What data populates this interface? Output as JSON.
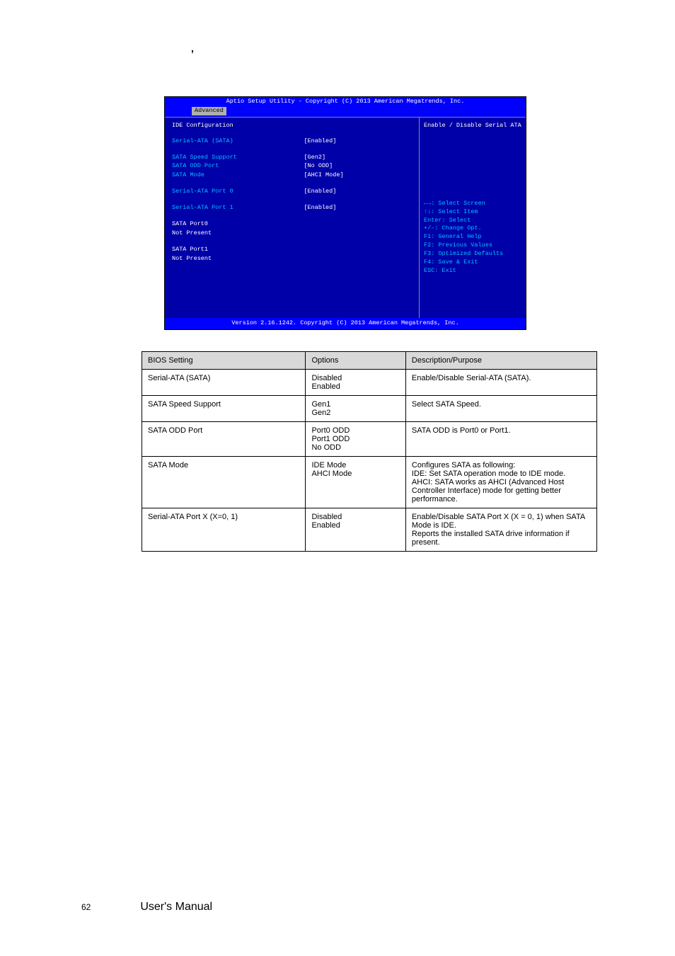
{
  "stray": ",",
  "bios": {
    "topbar": "Aptio Setup Utility - Copyright (C) 2013 American Megatrends, Inc.",
    "tab": "Advanced",
    "heading": "IDE Configuration",
    "rows": [
      {
        "label": "Serial-ATA (SATA)",
        "value": "[Enabled]",
        "white": false
      },
      {
        "spacer": true
      },
      {
        "label": "SATA Speed Support",
        "value": "[Gen2]"
      },
      {
        "label": "SATA ODD Port",
        "value": "[No ODD]"
      },
      {
        "label": "SATA Mode",
        "value": "[AHCI Mode]"
      },
      {
        "spacer": true
      },
      {
        "label": "Serial-ATA Port 0",
        "value": "[Enabled]"
      },
      {
        "spacer": true
      },
      {
        "label": "Serial-ATA Port 1",
        "value": "[Enabled]"
      },
      {
        "spacer": true
      },
      {
        "label": "SATA Port0",
        "value": "",
        "white": true
      },
      {
        "label": "Not Present",
        "value": "",
        "white": true
      },
      {
        "spacer": true
      },
      {
        "label": "SATA Port1",
        "value": "",
        "white": true
      },
      {
        "label": "Not Present",
        "value": "",
        "white": true
      }
    ],
    "help_item": "Enable / Disable Serial ATA",
    "nav": [
      "←→: Select Screen",
      "↑↓: Select Item",
      "Enter: Select",
      "+/-: Change Opt.",
      "F1: General Help",
      "F2: Previous Values",
      "F3: Optimized Defaults",
      "F4: Save & Exit",
      "ESC: Exit"
    ],
    "footerbar": "Version 2.16.1242. Copyright (C) 2013 American Megatrends, Inc."
  },
  "table": {
    "headers": [
      "BIOS Setting",
      "Options",
      "Description/Purpose"
    ],
    "rows": [
      {
        "name": "Serial-ATA (SATA)",
        "opts": "Disabled\nEnabled",
        "desc": "Enable/Disable Serial-ATA (SATA)."
      },
      {
        "name": "SATA Speed Support",
        "opts": "Gen1\nGen2",
        "desc": "Select SATA Speed."
      },
      {
        "name": "SATA ODD Port",
        "opts": "Port0 ODD\nPort1 ODD\nNo ODD",
        "desc": "SATA ODD is Port0 or Port1."
      },
      {
        "name": "SATA Mode",
        "opts": "IDE Mode\nAHCI Mode",
        "desc": "Configures SATA as following:\nIDE: Set SATA operation mode to IDE mode.\nAHCI: SATA works as AHCI (Advanced Host Controller Interface) mode for getting better performance."
      },
      {
        "name": "Serial-ATA Port X (X=0, 1)",
        "opts": "Disabled\nEnabled",
        "desc": "Enable/Disable SATA Port X (X = 0, 1) when SATA Mode is IDE.\nReports the installed SATA drive information if present."
      }
    ]
  },
  "footer": {
    "page": "62",
    "title": "User's Manual"
  }
}
